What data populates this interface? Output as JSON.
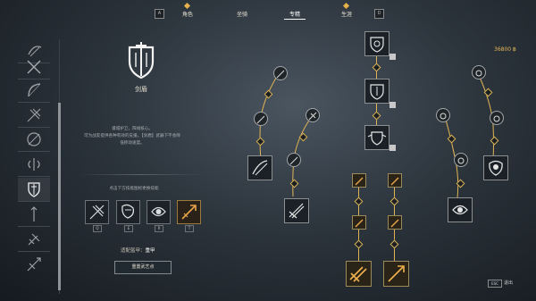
{
  "top_nav": {
    "key_left": "A",
    "key_right": "D",
    "tabs": [
      "角色",
      "坐骑",
      "专精",
      "生涯"
    ],
    "active_tab": "专精"
  },
  "sidebar": {
    "icons": [
      "bow-slash-icon",
      "crossed-swords-icon",
      "bow-icon",
      "crossbow-icon",
      "orb-icon",
      "wing-icon",
      "sword-shield-icon",
      "staff-icon",
      "gauntlet-icon",
      "spear-icon"
    ],
    "selected": "sword-shield-icon"
  },
  "weapon": {
    "name": "剑盾",
    "description_lines": [
      "谨城护卫，阵线核心。",
      "可为战友提供各种有效的支援。【剑盾】武器下不会降",
      "低移动速度。"
    ]
  },
  "skills": {
    "hint": "点击下方技能图标更换技能",
    "keys": [
      "Q",
      "E",
      "R",
      "T"
    ]
  },
  "armor": {
    "label": "适配盔甲：",
    "value": "重甲"
  },
  "reset_button": "重置武艺点",
  "points": "36800",
  "esc": {
    "key": "ESC",
    "label": "退出"
  },
  "colors": {
    "accent": "#e0b454",
    "text": "#d9d4c8"
  }
}
